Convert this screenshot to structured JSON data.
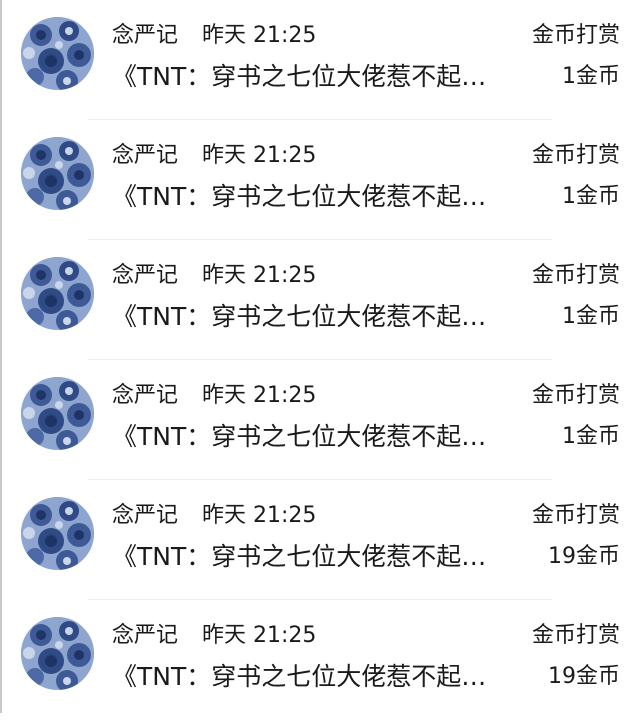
{
  "rewards": [
    {
      "user": "念严记",
      "time": "昨天 21:25",
      "action": "金币打赏",
      "book_title": "《TNT：穿书之七位大佬惹不起…",
      "amount": "1金币"
    },
    {
      "user": "念严记",
      "time": "昨天 21:25",
      "action": "金币打赏",
      "book_title": "《TNT：穿书之七位大佬惹不起…",
      "amount": "1金币"
    },
    {
      "user": "念严记",
      "time": "昨天 21:25",
      "action": "金币打赏",
      "book_title": "《TNT：穿书之七位大佬惹不起…",
      "amount": "1金币"
    },
    {
      "user": "念严记",
      "time": "昨天 21:25",
      "action": "金币打赏",
      "book_title": "《TNT：穿书之七位大佬惹不起…",
      "amount": "1金币"
    },
    {
      "user": "念严记",
      "time": "昨天 21:25",
      "action": "金币打赏",
      "book_title": "《TNT：穿书之七位大佬惹不起…",
      "amount": "19金币"
    },
    {
      "user": "念严记",
      "time": "昨天 21:25",
      "action": "金币打赏",
      "book_title": "《TNT：穿书之七位大佬惹不起…",
      "amount": "19金币"
    }
  ],
  "avatar": {
    "icon": "blue-roses-avatar-icon",
    "colors": [
      "#8ea6cf",
      "#3d5a96",
      "#1f3466",
      "#c9d5ea"
    ]
  }
}
